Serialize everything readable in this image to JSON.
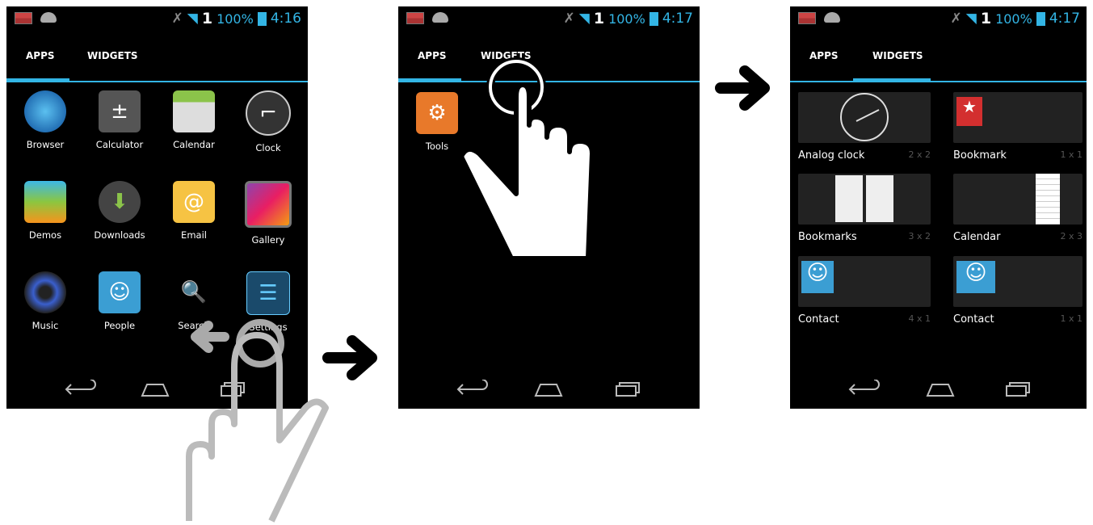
{
  "status": [
    {
      "time": "4:16",
      "pct": "100%",
      "signal": "1"
    },
    {
      "time": "4:17",
      "pct": "100%",
      "signal": "1"
    },
    {
      "time": "4:17",
      "pct": "100%",
      "signal": "1"
    }
  ],
  "tabs": {
    "apps": "APPS",
    "widgets": "WIDGETS"
  },
  "apps": [
    {
      "label": "Browser",
      "icon": "globe-icon"
    },
    {
      "label": "Calculator",
      "icon": "calculator-icon"
    },
    {
      "label": "Calendar",
      "icon": "calendar-icon"
    },
    {
      "label": "Clock",
      "icon": "clock-icon"
    },
    {
      "label": "Demos",
      "icon": "layers-icon"
    },
    {
      "label": "Downloads",
      "icon": "download-icon"
    },
    {
      "label": "Email",
      "icon": "email-icon"
    },
    {
      "label": "Gallery",
      "icon": "gallery-icon"
    },
    {
      "label": "Music",
      "icon": "speaker-icon"
    },
    {
      "label": "People",
      "icon": "contact-card-icon"
    },
    {
      "label": "Search",
      "icon": "magnifier-icon"
    },
    {
      "label": "Settings",
      "icon": "sliders-icon"
    }
  ],
  "apps2": [
    {
      "label": "Tools",
      "icon": "tools-icon"
    }
  ],
  "widgets": [
    {
      "label": "Analog clock",
      "size": "2 x 2"
    },
    {
      "label": "Bookmark",
      "size": "1 x 1"
    },
    {
      "label": "Bookmarks",
      "size": "3 x 2"
    },
    {
      "label": "Calendar",
      "size": "2 x 3"
    },
    {
      "label": "Contact",
      "size": "4 x 1"
    },
    {
      "label": "Contact",
      "size": "1 x 1"
    }
  ],
  "colors": {
    "accent": "#33b5e5",
    "background": "#000000"
  }
}
